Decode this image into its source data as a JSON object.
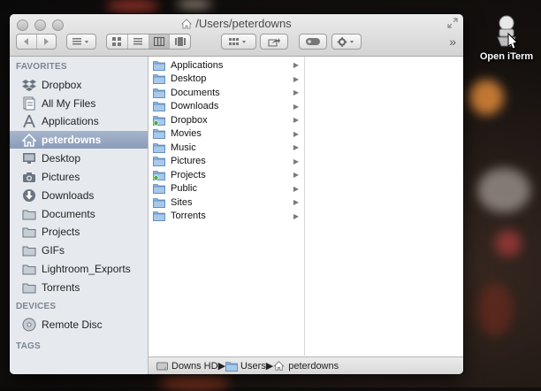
{
  "desktop": {
    "icon_label": "Open iTerm",
    "icon_name": "open-iterm-app-icon"
  },
  "window": {
    "title": "/Users/peterdowns",
    "title_icon": "home-icon"
  },
  "toolbar": {
    "back": "back-icon",
    "forward": "forward-icon",
    "arrange": "arrange-icon",
    "views": [
      "icon-view-icon",
      "list-view-icon",
      "column-view-icon",
      "cover-flow-view-icon"
    ],
    "active_view_index": 2,
    "group": "group-icon",
    "share": "share-icon",
    "tags": "tags-icon",
    "action": "gear-icon",
    "overflow": "»"
  },
  "sidebar": {
    "favorites_label": "FAVORITES",
    "devices_label": "DEVICES",
    "tags_label": "TAGS",
    "favorites": [
      {
        "label": "Dropbox",
        "icon": "dropbox-icon"
      },
      {
        "label": "All My Files",
        "icon": "all-files-icon"
      },
      {
        "label": "Applications",
        "icon": "applications-icon"
      },
      {
        "label": "peterdowns",
        "icon": "home-icon",
        "selected": true
      },
      {
        "label": "Desktop",
        "icon": "desktop-icon"
      },
      {
        "label": "Pictures",
        "icon": "camera-icon"
      },
      {
        "label": "Downloads",
        "icon": "downloads-icon"
      },
      {
        "label": "Documents",
        "icon": "folder-icon"
      },
      {
        "label": "Projects",
        "icon": "folder-icon"
      },
      {
        "label": "GIFs",
        "icon": "folder-icon"
      },
      {
        "label": "Lightroom_Exports",
        "icon": "folder-icon"
      },
      {
        "label": "Torrents",
        "icon": "folder-icon"
      }
    ],
    "devices": [
      {
        "label": "Remote Disc",
        "icon": "disc-icon"
      }
    ]
  },
  "column1": {
    "items": [
      {
        "label": "Applications",
        "icon": "folder-icon"
      },
      {
        "label": "Desktop",
        "icon": "folder-icon"
      },
      {
        "label": "Documents",
        "icon": "folder-icon"
      },
      {
        "label": "Downloads",
        "icon": "folder-icon"
      },
      {
        "label": "Dropbox",
        "icon": "dropbox-folder-icon"
      },
      {
        "label": "Movies",
        "icon": "folder-icon"
      },
      {
        "label": "Music",
        "icon": "folder-icon"
      },
      {
        "label": "Pictures",
        "icon": "folder-icon"
      },
      {
        "label": "Projects",
        "icon": "dropbox-folder-icon"
      },
      {
        "label": "Public",
        "icon": "folder-icon"
      },
      {
        "label": "Sites",
        "icon": "folder-icon"
      },
      {
        "label": "Torrents",
        "icon": "folder-icon"
      }
    ]
  },
  "path_bar": {
    "segments": [
      {
        "label": "Downs HD",
        "icon": "hard-drive-icon"
      },
      {
        "label": "Users",
        "icon": "folder-icon"
      },
      {
        "label": "peterdowns",
        "icon": "home-icon"
      }
    ]
  }
}
